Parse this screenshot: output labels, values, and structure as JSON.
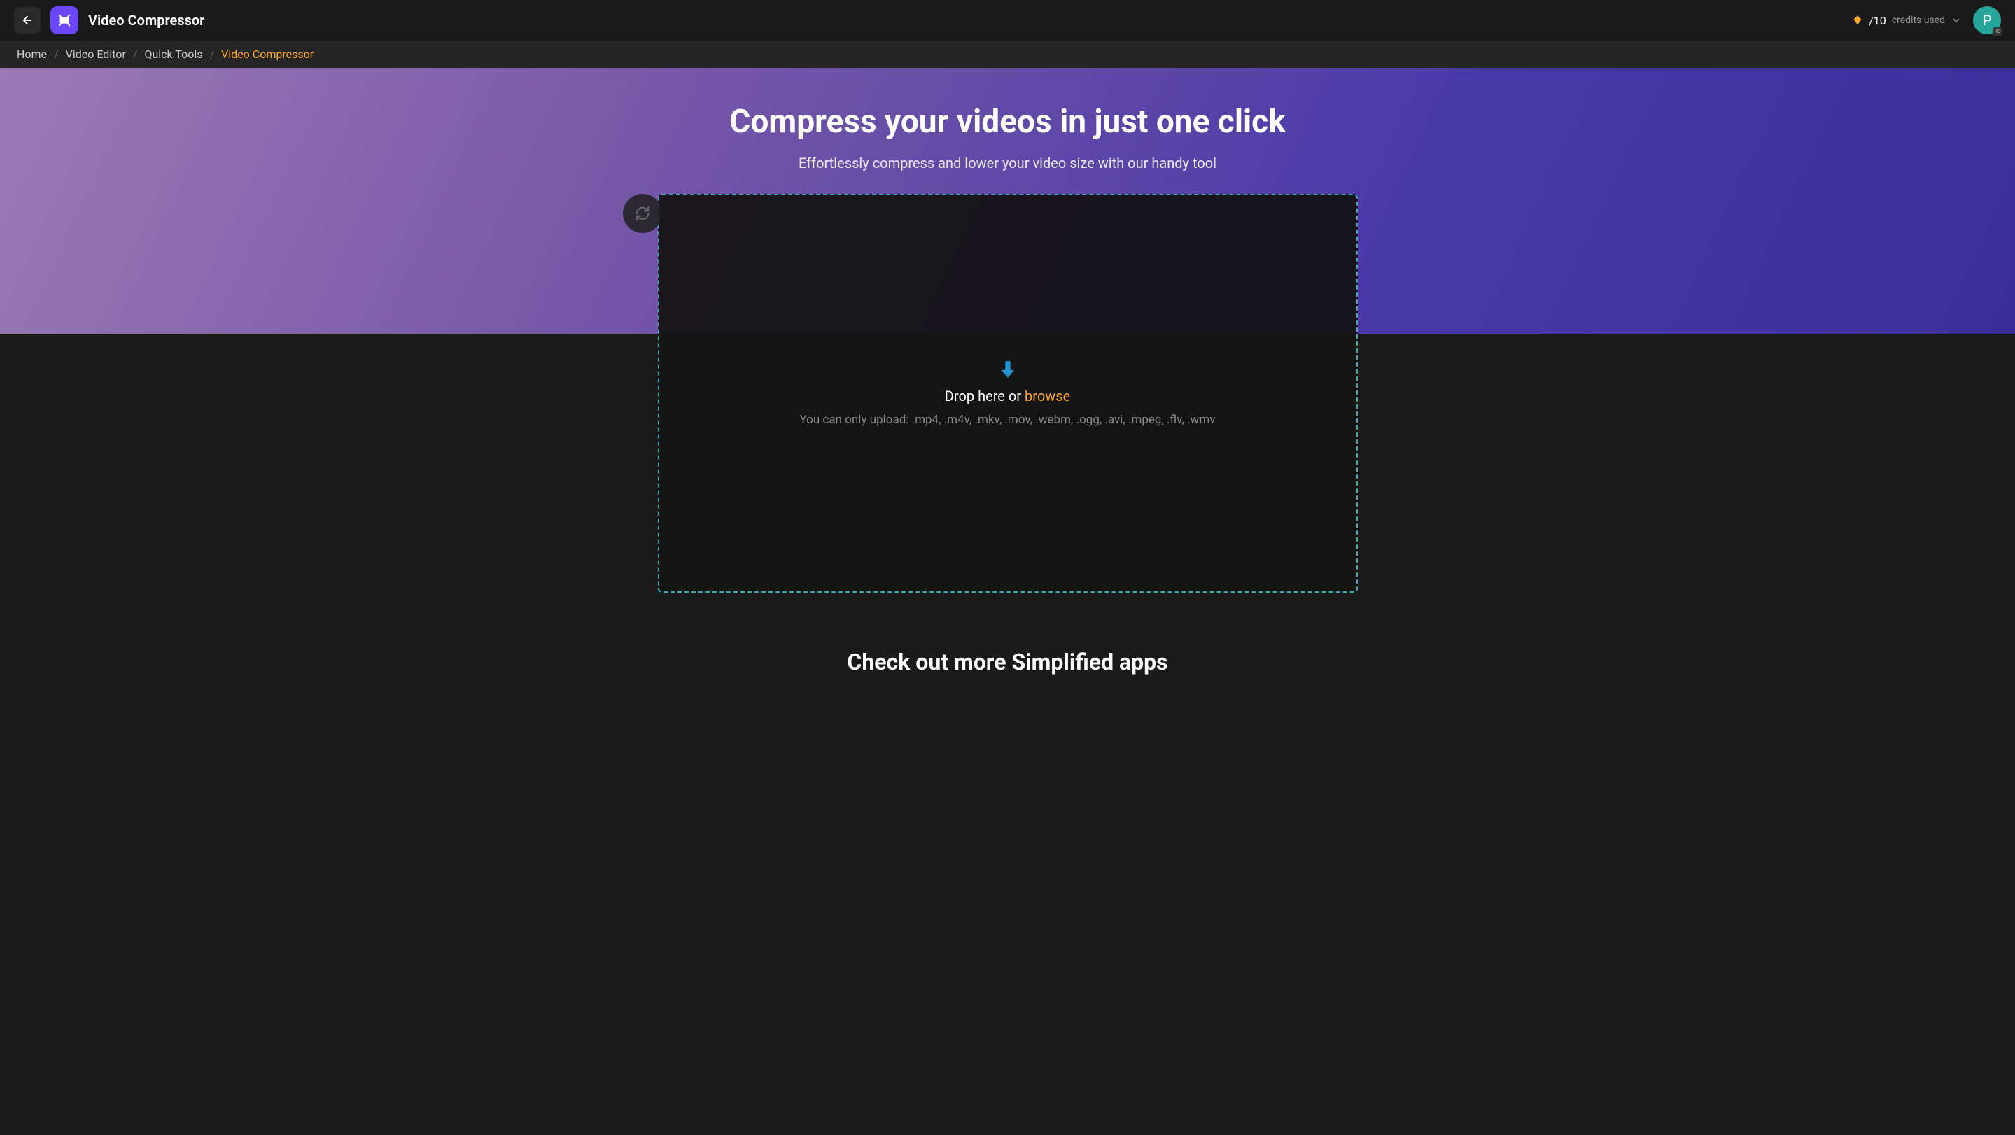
{
  "header": {
    "app_title": "Video Compressor",
    "credits": {
      "count": "/10",
      "label": "credits used"
    },
    "avatar": {
      "letter": "P",
      "badge": "RS"
    }
  },
  "breadcrumb": {
    "items": [
      {
        "label": "Home",
        "active": false
      },
      {
        "label": "Video Editor",
        "active": false
      },
      {
        "label": "Quick Tools",
        "active": false
      },
      {
        "label": "Video Compressor",
        "active": true
      }
    ]
  },
  "hero": {
    "title": "Compress your videos in just one click",
    "subtitle": "Effortlessly compress and lower your video size with our handy tool"
  },
  "drop_zone": {
    "drop_text": "Drop here or ",
    "browse_text": "browse",
    "file_types": "You can only upload: .mp4, .m4v, .mkv, .mov, .webm, .ogg, .avi, .mpeg, .flv, .wmv"
  },
  "more_apps": {
    "title": "Check out more Simplified apps"
  }
}
